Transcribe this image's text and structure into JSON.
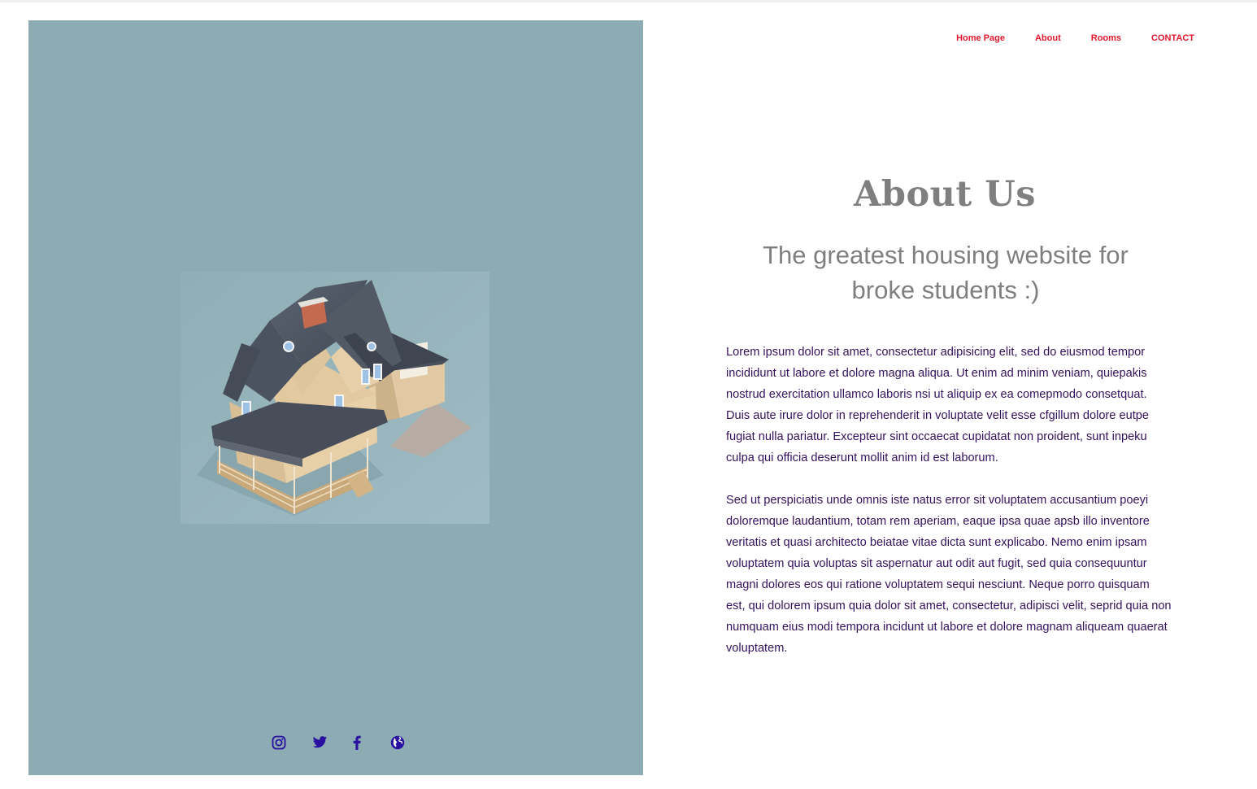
{
  "nav": {
    "items": [
      {
        "label": "Home Page"
      },
      {
        "label": "About"
      },
      {
        "label": "Rooms"
      },
      {
        "label": "CONTACT"
      }
    ],
    "color": "#e0182d"
  },
  "hero": {
    "background": "#8cabb3",
    "image": "isometric-house-illustration"
  },
  "about": {
    "title": "About Us",
    "subtitle": "The greatest housing website for broke students :)",
    "paragraphs": [
      "Lorem ipsum dolor sit amet, consectetur adipisicing elit, sed do eiusmod tempor incididunt ut labore et dolore magna aliqua. Ut enim ad minim veniam, quiepakis nostrud exercitation ullamco laboris nsi ut aliquip ex ea comepmodo consetquat. Duis aute irure dolor in reprehenderit in voluptate velit esse cfgillum dolore eutpe fugiat nulla pariatur. Excepteur sint occaecat cupidatat non proident, sunt inpeku culpa qui officia deserunt mollit anim id est laborum.",
      "Sed ut perspiciatis unde omnis iste natus error sit voluptatem accusantium poeyi doloremque laudantium, totam rem aperiam, eaque ipsa quae apsb illo inventore veritatis et quasi architecto beiatae vitae dicta sunt explicabo. Nemo enim ipsam voluptatem quia voluptas sit aspernatur aut odit aut fugit, sed quia consequuntur magni dolores eos qui ratione voluptatem sequi nesciunt. Neque porro quisquam est, qui dolorem ipsum quia dolor sit amet, consectetur, adipisci velit, seprid quia non numquam eius modi tempora incidunt ut labore et dolore magnam aliqueam quaerat voluptatem."
    ]
  },
  "socials": {
    "icons": [
      "instagram-icon",
      "twitter-icon",
      "facebook-icon",
      "globe-icon"
    ],
    "color": "#2a10a0"
  }
}
